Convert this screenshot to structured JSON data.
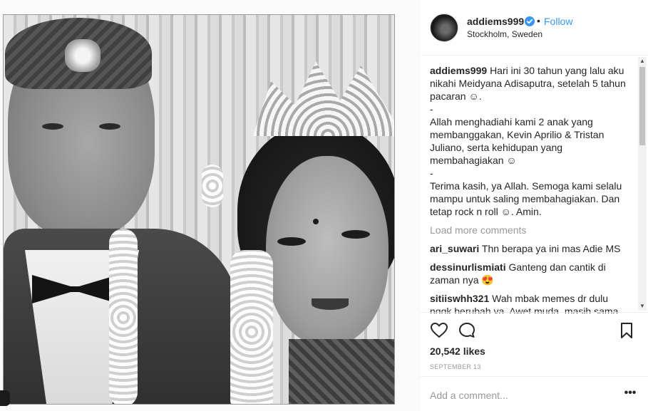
{
  "post": {
    "username": "addiems999",
    "verified": true,
    "separator": "•",
    "follow_label": "Follow",
    "location": "Stockholm, Sweden",
    "caption": {
      "username": "addiems999",
      "text": "Hari ini 30 tahun yang lalu aku nikahi Meidyana Adisaputra, setelah 5 tahun pacaran ☺.\n-\nAllah menghadiahi kami 2 anak yang membanggakan, Kevin Aprilio & Tristan Juliano, serta kehidupan yang membahagiakan ☺\n-\nTerima kasih, ya Allah. Semoga kami selalu mampu untuk saling membahagiakan. Dan tetap rock n roll ☺. Amin."
    },
    "load_more_label": "Load more comments",
    "comments": [
      {
        "username": "ari_suwari",
        "text": "Thn berapa ya ini mas Adie MS"
      },
      {
        "username": "dessinurlismiati",
        "text": "Ganteng dan cantik di zaman nya 😍"
      },
      {
        "username": "sitiiswhh321",
        "text": "Wah mbak memes dr dulu nggk berubah ya. Awet muda, masih sama"
      }
    ],
    "likes": "20,542 likes",
    "date": "SEPTEMBER 13",
    "add_comment_placeholder": "Add a comment...",
    "more_options": "•••"
  },
  "icons": {
    "verified": "verified-badge-icon",
    "like": "heart-icon",
    "comment": "speech-bubble-icon",
    "save": "bookmark-icon",
    "more": "more-options-icon"
  },
  "colors": {
    "link": "#3897f0",
    "verified": "#3897f0",
    "muted": "#999999",
    "text": "#262626",
    "divider": "#efefef"
  }
}
